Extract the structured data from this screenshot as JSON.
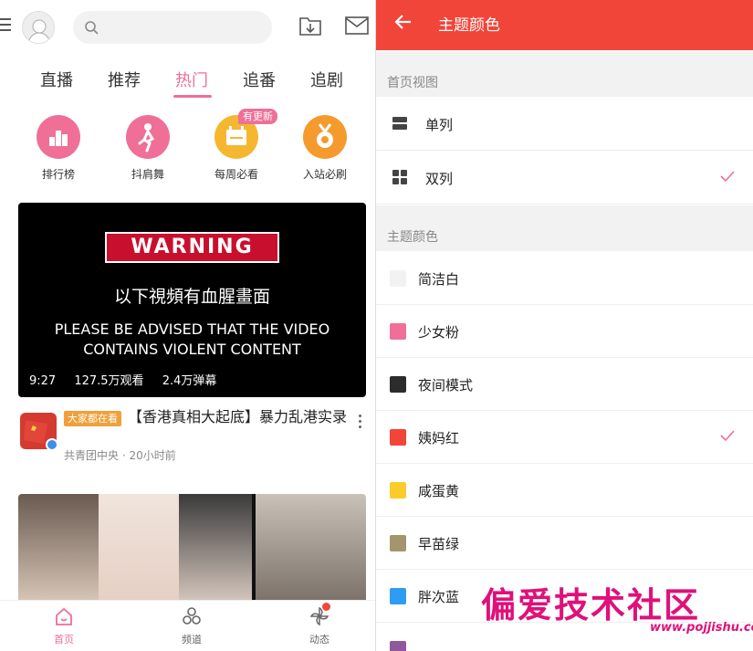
{
  "left": {
    "tabs": [
      "直播",
      "推荐",
      "热门",
      "追番",
      "追剧"
    ],
    "active_tab": "热门",
    "categories": [
      {
        "label": "排行榜",
        "color": "#ef6f97",
        "icon": "ranking-icon"
      },
      {
        "label": "抖肩舞",
        "color": "#ef6f97",
        "icon": "dance-icon"
      },
      {
        "label": "每周必看",
        "color": "#f6b730",
        "icon": "calendar-icon"
      },
      {
        "label": "入站必刷",
        "color": "#f59a2c",
        "icon": "medal-icon"
      }
    ],
    "new_badge": "有更新",
    "video": {
      "warning": "WARNING",
      "cn_text": "以下視頻有血腥畫面",
      "en_line1": "PLEASE BE ADVISED THAT THE VIDEO",
      "en_line2": "CONTAINS VIOLENT CONTENT",
      "duration": "9:27",
      "views": "127.5万观看",
      "danmaku": "2.4万弹幕"
    },
    "post": {
      "tag": "大家都在看",
      "title": "【香港真相大起底】暴力乱港实录",
      "author": "共青团中央",
      "time": "20小时前"
    },
    "bottom_nav": [
      {
        "label": "首页",
        "icon": "home-icon"
      },
      {
        "label": "频道",
        "icon": "channel-icon"
      },
      {
        "label": "动态",
        "icon": "activity-icon"
      }
    ]
  },
  "right": {
    "title": "主题颜色",
    "section_view": "首页视图",
    "view_options": [
      {
        "label": "单列",
        "checked": false
      },
      {
        "label": "双列",
        "checked": true
      }
    ],
    "section_color": "主题颜色",
    "themes": [
      {
        "label": "简洁白",
        "color": "#f2f2f2",
        "checked": false
      },
      {
        "label": "少女粉",
        "color": "#ef6f97",
        "checked": false
      },
      {
        "label": "夜间模式",
        "color": "#2c2c2c",
        "checked": false
      },
      {
        "label": "姨妈红",
        "color": "#f1453a",
        "checked": true
      },
      {
        "label": "咸蛋黄",
        "color": "#f9cc2b",
        "checked": false
      },
      {
        "label": "早苗绿",
        "color": "#a3956c",
        "checked": false
      },
      {
        "label": "胖次蓝",
        "color": "#2f9cf3",
        "checked": false
      }
    ],
    "accent": "#f1453a",
    "check_color": "#ef6f97"
  },
  "watermark": {
    "title": "偏爱技术社区",
    "url": "www.pojjishu.com"
  }
}
